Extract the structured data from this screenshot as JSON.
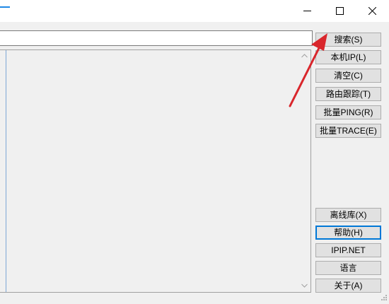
{
  "window": {
    "controls": {
      "minimize": "minimize-icon",
      "maximize": "maximize-icon",
      "close": "close-icon"
    }
  },
  "search": {
    "value": "",
    "placeholder": ""
  },
  "buttons": {
    "search": "搜索(S)",
    "local_ip": "本机IP(L)",
    "clear": "清空(C)",
    "route_trace": "路由跟踪(T)",
    "batch_ping": "批量PING(R)",
    "batch_trace": "批量TRACE(E)",
    "offline_db": "离线库(X)",
    "help": "帮助(H)",
    "ipip_net": "IPIP.NET",
    "language": "语言",
    "about": "关于(A)"
  },
  "colors": {
    "accent": "#0078d7",
    "annotation_arrow": "#d9262c",
    "titlebar_icon": "#1e88e5"
  }
}
